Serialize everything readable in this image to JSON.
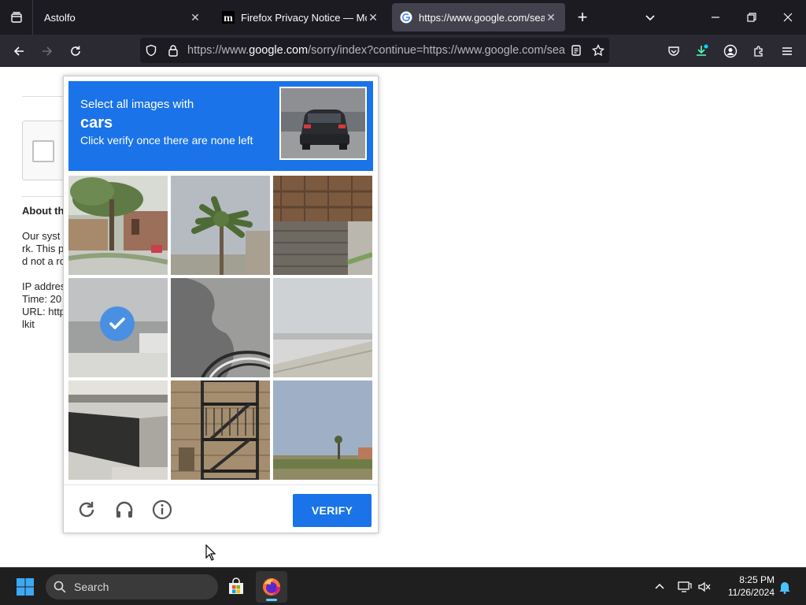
{
  "browser": {
    "tabs": [
      {
        "title": "Astolfo",
        "active": false,
        "favicon": "none"
      },
      {
        "title": "Firefox Privacy Notice — Mozill",
        "active": false,
        "favicon": "mozilla-m-icon"
      },
      {
        "title": "https://www.google.com/search",
        "active": true,
        "favicon": "google-g-icon"
      }
    ],
    "url": {
      "prefix": "https://www.",
      "domain": "google.com",
      "suffix": "/sorry/index?continue=https://www.google.com/search"
    },
    "accent_color": "#1a73e8"
  },
  "page": {
    "about_heading": "About th",
    "body_lines": [
      "Our syst",
      "rk. This p",
      "d not a ro"
    ],
    "info_lines": [
      "IP addres",
      "Time: 20",
      "URL: http",
      "lkit"
    ]
  },
  "captcha": {
    "instruction": "Select all images with",
    "keyword": "cars",
    "sub_instruction": "Click verify once there are none left",
    "sample_icon": "car-rear-photo",
    "tiles": [
      {
        "content": "street-with-tree",
        "selected": false
      },
      {
        "content": "palm-tree",
        "selected": false
      },
      {
        "content": "bridge-underside",
        "selected": false
      },
      {
        "content": "street-road",
        "selected": true
      },
      {
        "content": "shadow-on-ground",
        "selected": false
      },
      {
        "content": "empty-road",
        "selected": false
      },
      {
        "content": "concrete-structure",
        "selected": false
      },
      {
        "content": "fire-escape",
        "selected": false
      },
      {
        "content": "sky-landscape",
        "selected": false
      }
    ],
    "verify_label": "VERIFY"
  },
  "taskbar": {
    "search_label": "Search",
    "time": "8:25 PM",
    "date": "11/26/2024"
  }
}
